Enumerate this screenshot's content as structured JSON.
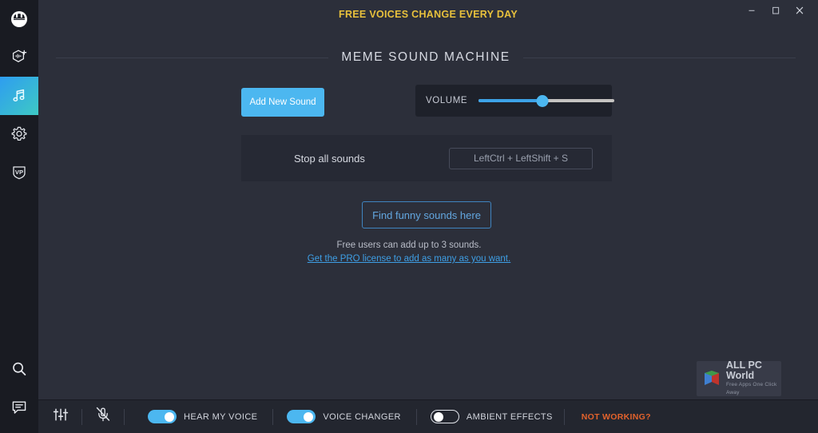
{
  "window": {
    "promo_banner": "FREE VOICES CHANGE EVERY DAY",
    "minimize_label": "Minimize",
    "maximize_label": "Maximize",
    "close_label": "Close"
  },
  "sidebar": {
    "items": [
      {
        "icon": "voicemod-logo-icon",
        "label": "Voicemod",
        "active": false
      },
      {
        "icon": "voicelab-add-icon",
        "label": "Voicelab",
        "active": false
      },
      {
        "icon": "music-note-icon",
        "label": "Soundboard",
        "active": true
      },
      {
        "icon": "gear-icon",
        "label": "Settings",
        "active": false
      },
      {
        "icon": "vp-shield-icon",
        "label": "Voicemod Pro",
        "active": false
      }
    ],
    "bottom_items": [
      {
        "icon": "search-icon",
        "label": "Search"
      },
      {
        "icon": "chat-icon",
        "label": "Support chat"
      }
    ]
  },
  "main": {
    "section_title": "MEME SOUND MACHINE",
    "add_sound_label": "Add New Sound",
    "volume": {
      "label": "VOLUME",
      "value": 47,
      "min": 0,
      "max": 100
    },
    "stop_all": {
      "label": "Stop all sounds",
      "hotkey": "LeftCtrl + LeftShift + S"
    },
    "find_sounds_label": "Find funny sounds here",
    "free_note": "Free users can add up to 3 sounds.",
    "pro_link": "Get the PRO license to add as many as you want."
  },
  "watermark": {
    "title": "ALL PC World",
    "subtitle": "Free Apps One Click Away"
  },
  "bottombar": {
    "equalizer_label": "Voice settings",
    "mute_label": "Mute microphone",
    "toggles": [
      {
        "label": "HEAR MY VOICE",
        "state": "on"
      },
      {
        "label": "VOICE CHANGER",
        "state": "on"
      },
      {
        "label": "AMBIENT EFFECTS",
        "state": "off"
      }
    ],
    "not_working_label": "NOT WORKING?"
  },
  "colors": {
    "accent_blue": "#4cb7f0",
    "promo_yellow": "#e8c13c",
    "alert_orange": "#e2622c",
    "sidebar_bg": "#191b22",
    "content_bg": "#2c2f3a",
    "panel_bg": "#262934",
    "volume_bg": "#1e212a"
  }
}
